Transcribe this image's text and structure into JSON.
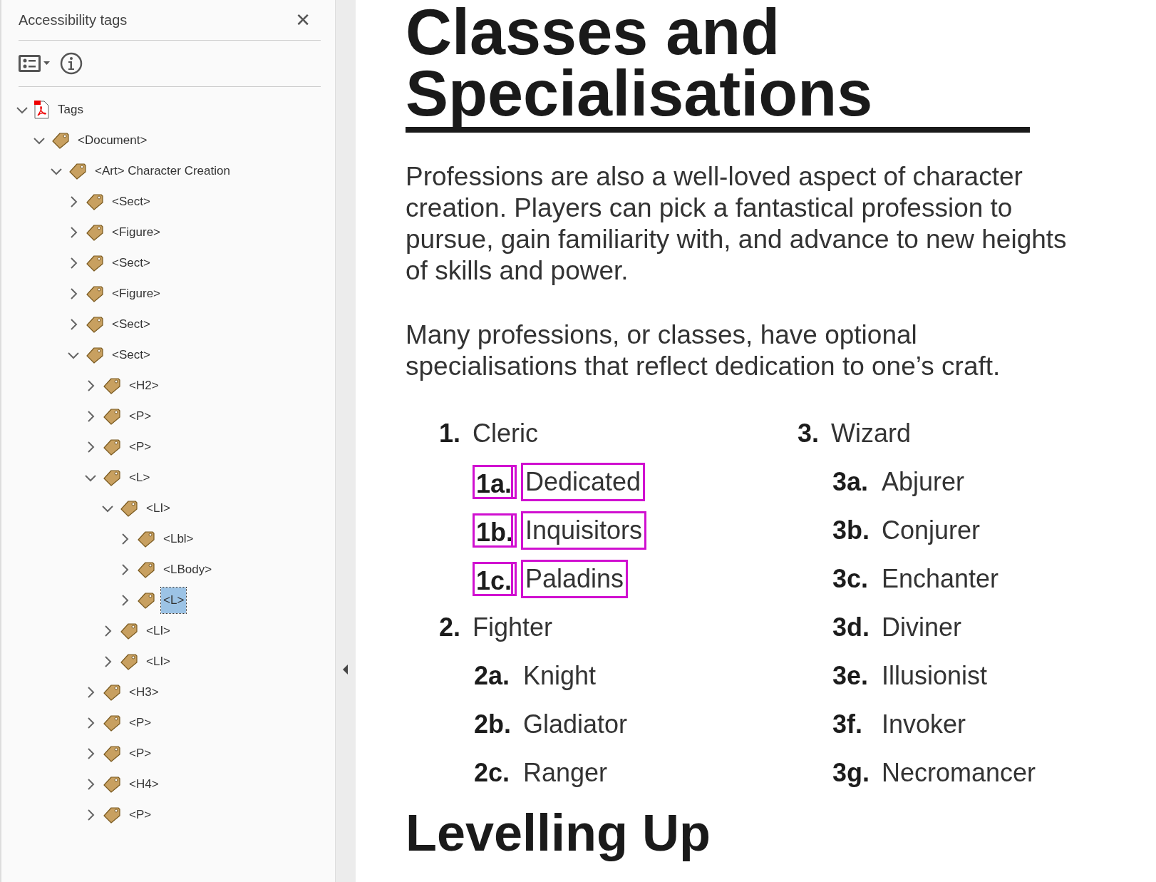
{
  "panel": {
    "title": "Accessibility tags",
    "close": "✕"
  },
  "tree": [
    {
      "label": "Tags",
      "kind": "root",
      "expanded": true,
      "selected": false,
      "children": [
        {
          "label": "<Document>",
          "kind": "tag",
          "expanded": true,
          "selected": false,
          "children": [
            {
              "label": "<Art> Character Creation",
              "kind": "tag",
              "expanded": true,
              "selected": false,
              "children": [
                {
                  "label": "<Sect>",
                  "kind": "tag",
                  "expanded": false,
                  "selected": false
                },
                {
                  "label": "<Figure>",
                  "kind": "tag",
                  "expanded": false,
                  "selected": false
                },
                {
                  "label": "<Sect>",
                  "kind": "tag",
                  "expanded": false,
                  "selected": false
                },
                {
                  "label": "<Figure>",
                  "kind": "tag",
                  "expanded": false,
                  "selected": false
                },
                {
                  "label": "<Sect>",
                  "kind": "tag",
                  "expanded": false,
                  "selected": false
                },
                {
                  "label": "<Sect>",
                  "kind": "tag",
                  "expanded": true,
                  "selected": false,
                  "children": [
                    {
                      "label": "<H2>",
                      "kind": "tag",
                      "expanded": false,
                      "selected": false
                    },
                    {
                      "label": "<P>",
                      "kind": "tag",
                      "expanded": false,
                      "selected": false
                    },
                    {
                      "label": "<P>",
                      "kind": "tag",
                      "expanded": false,
                      "selected": false
                    },
                    {
                      "label": "<L>",
                      "kind": "tag",
                      "expanded": true,
                      "selected": false,
                      "children": [
                        {
                          "label": "<LI>",
                          "kind": "tag",
                          "expanded": true,
                          "selected": false,
                          "children": [
                            {
                              "label": "<Lbl>",
                              "kind": "tag",
                              "expanded": false,
                              "selected": false
                            },
                            {
                              "label": "<LBody>",
                              "kind": "tag",
                              "expanded": false,
                              "selected": false
                            },
                            {
                              "label": "<L>",
                              "kind": "tag",
                              "expanded": false,
                              "selected": true
                            }
                          ]
                        },
                        {
                          "label": "<LI>",
                          "kind": "tag",
                          "expanded": false,
                          "selected": false
                        },
                        {
                          "label": "<LI>",
                          "kind": "tag",
                          "expanded": false,
                          "selected": false
                        }
                      ]
                    },
                    {
                      "label": "<H3>",
                      "kind": "tag",
                      "expanded": false,
                      "selected": false
                    },
                    {
                      "label": "<P>",
                      "kind": "tag",
                      "expanded": false,
                      "selected": false
                    },
                    {
                      "label": "<P>",
                      "kind": "tag",
                      "expanded": false,
                      "selected": false
                    },
                    {
                      "label": "<H4>",
                      "kind": "tag",
                      "expanded": false,
                      "selected": false
                    },
                    {
                      "label": "<P>",
                      "kind": "tag",
                      "expanded": false,
                      "selected": false
                    }
                  ]
                }
              ]
            }
          ]
        }
      ]
    }
  ],
  "document": {
    "title_lines": [
      "Classes and",
      "Specialisations"
    ],
    "paragraphs": [
      "Professions are also a well-loved aspect of character creation. Players can pick a fantastical profession to pursue, gain familiarity with, and advance to new heights of skills and power.",
      "Many professions, or classes, have optional specialisations that reflect dedication to one’s craft."
    ],
    "list_columns": [
      {
        "items": [
          {
            "number": "1.",
            "name": "Cleric",
            "subitems": [
              {
                "label": "1a.",
                "name": "Dedicated",
                "highlighted": true
              },
              {
                "label": "1b.",
                "name": "Inquisitors",
                "highlighted": true
              },
              {
                "label": "1c.",
                "name": "Paladins",
                "highlighted": true
              }
            ]
          },
          {
            "number": "2.",
            "name": "Fighter",
            "subitems": [
              {
                "label": "2a.",
                "name": "Knight",
                "highlighted": false
              },
              {
                "label": "2b.",
                "name": "Gladiator",
                "highlighted": false
              },
              {
                "label": "2c.",
                "name": "Ranger",
                "highlighted": false
              }
            ]
          }
        ]
      },
      {
        "items": [
          {
            "number": "3.",
            "name": "Wizard",
            "subitems": [
              {
                "label": "3a.",
                "name": "Abjurer",
                "highlighted": false
              },
              {
                "label": "3b.",
                "name": "Conjurer",
                "highlighted": false
              },
              {
                "label": "3c.",
                "name": "Enchanter",
                "highlighted": false
              },
              {
                "label": "3d.",
                "name": "Diviner",
                "highlighted": false
              },
              {
                "label": "3e.",
                "name": "Illusionist",
                "highlighted": false
              },
              {
                "label": "3f.",
                "name": "Invoker",
                "highlighted": false
              },
              {
                "label": "3g.",
                "name": "Necromancer",
                "highlighted": false
              }
            ]
          }
        ]
      }
    ],
    "next_heading": "Levelling Up"
  }
}
